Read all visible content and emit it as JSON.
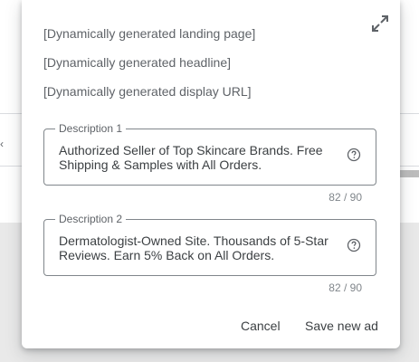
{
  "background": {
    "chevron": "‹"
  },
  "dialog": {
    "dynamic_lines": [
      "[Dynamically generated landing page]",
      "[Dynamically generated headline]",
      "[Dynamically generated display URL]"
    ],
    "expand_icon": "expand-icon",
    "descriptions": [
      {
        "label": "Description 1",
        "value": "Authorized Seller of Top Skincare Brands. Free Shipping & Samples with All Orders.",
        "counter": "82 / 90",
        "help_icon": "help-icon"
      },
      {
        "label": "Description 2",
        "value": "Dermatologist-Owned Site. Thousands of 5-Star Reviews. Earn 5% Back on All Orders.",
        "counter": "82 / 90",
        "help_icon": "help-icon"
      }
    ],
    "actions": {
      "cancel_label": "Cancel",
      "save_label": "Save new ad"
    }
  },
  "colors": {
    "text_primary": "#3c4043",
    "text_secondary": "#5f6368",
    "border": "#80868b",
    "backdrop": "#e9e9e9"
  }
}
